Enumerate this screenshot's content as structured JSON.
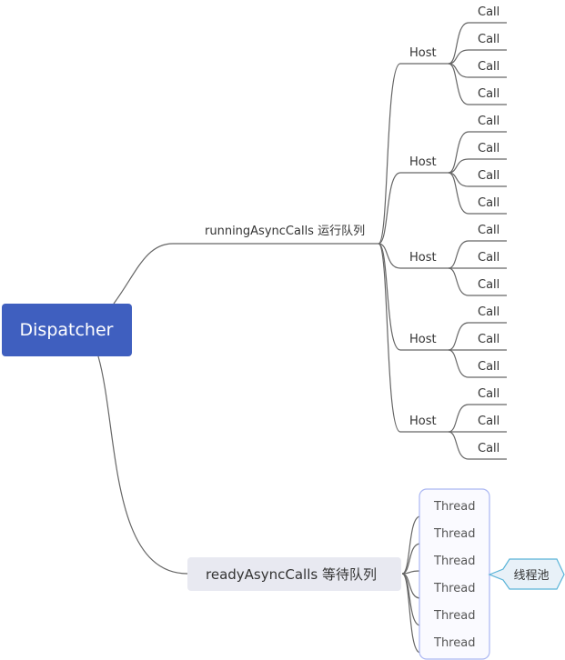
{
  "root": {
    "label": "Dispatcher",
    "color": "#3f5fbf"
  },
  "running": {
    "label": "runningAsyncCalls 运行队列",
    "hosts": [
      {
        "label": "Host",
        "calls": [
          "Call",
          "Call",
          "Call",
          "Call"
        ]
      },
      {
        "label": "Host",
        "calls": [
          "Call",
          "Call",
          "Call",
          "Call"
        ]
      },
      {
        "label": "Host",
        "calls": [
          "Call",
          "Call",
          "Call"
        ]
      },
      {
        "label": "Host",
        "calls": [
          "Call",
          "Call",
          "Call"
        ]
      },
      {
        "label": "Host",
        "calls": [
          "Call",
          "Call",
          "Call"
        ]
      }
    ]
  },
  "ready": {
    "label": "readyAsyncCalls 等待队列",
    "threads": [
      "Thread",
      "Thread",
      "Thread",
      "Thread",
      "Thread",
      "Thread"
    ],
    "callout": "线程池"
  }
}
